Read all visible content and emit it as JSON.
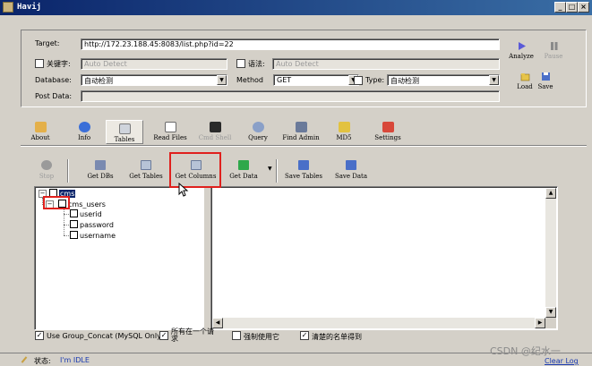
{
  "window": {
    "title": "Havij"
  },
  "form": {
    "target_label": "Target:",
    "target_value": "http://172.23.188.45:8083/list.php?id=22",
    "keyword_label": "关键字:",
    "keyword_placeholder": "Auto Detect",
    "syntax_label": "语法:",
    "syntax_placeholder": "Auto Detect",
    "database_label": "Database:",
    "database_value": "自动检测",
    "method_label": "Method",
    "method_value": "GET",
    "type_label": "Type:",
    "type_value": "自动检测",
    "postdata_label": "Post Data:"
  },
  "side_buttons": {
    "analyze": "Analyze",
    "pause": "Pause",
    "load": "Load",
    "save": "Save"
  },
  "tabs": [
    {
      "label": "About"
    },
    {
      "label": "Info"
    },
    {
      "label": "Tables"
    },
    {
      "label": "Read Files"
    },
    {
      "label": "Cmd Shell"
    },
    {
      "label": "Query"
    },
    {
      "label": "Find Admin"
    },
    {
      "label": "MD5"
    },
    {
      "label": "Settings"
    }
  ],
  "toolbar": {
    "stop": "Stop",
    "get_dbs": "Get DBs",
    "get_tables": "Get Tables",
    "get_columns": "Get Columns",
    "get_data": "Get Data",
    "save_tables": "Save Tables",
    "save_data": "Save Data"
  },
  "tree": {
    "db": "cms",
    "table": "cms_users",
    "columns": [
      "userid",
      "password",
      "username"
    ]
  },
  "options": {
    "group_concat": "Use Group_Concat (MySQL Only)",
    "all_in_one": "所有在一个请求",
    "force_use": "强制使用它",
    "clear_name": "清楚的名单得到"
  },
  "status": {
    "label": "状态:",
    "text": "I'm IDLE",
    "clear_log": "Clear Log",
    "watermark": "CSDN @纪水一"
  },
  "colors": {
    "title_left": "#0a246a",
    "title_right": "#3a6ea5",
    "highlight": "#e0201d",
    "selection": "#0a246a"
  }
}
